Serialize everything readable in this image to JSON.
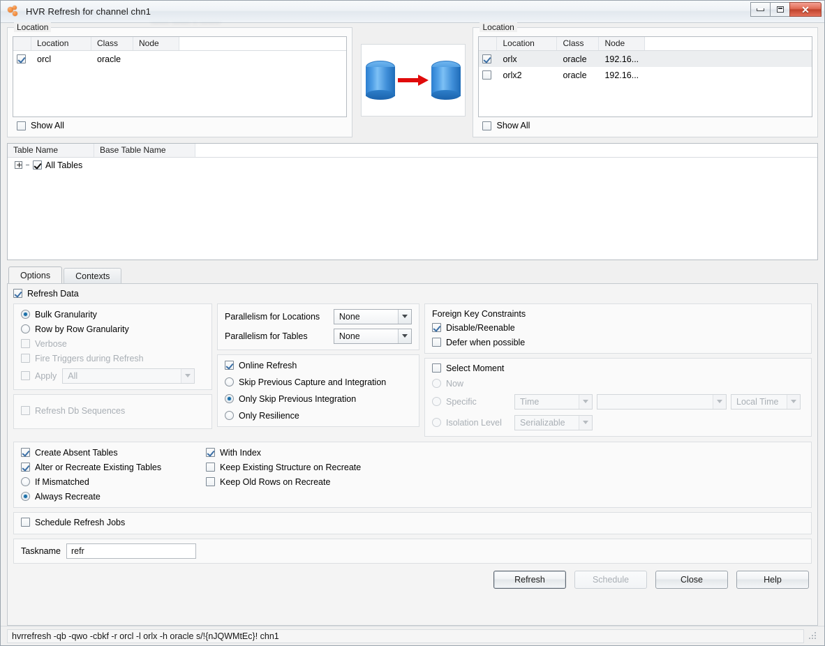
{
  "window": {
    "title": "HVR Refresh for channel chn1",
    "icon": "hvr-beads-icon",
    "ghost_text": "ghosted overlapping window text",
    "controls": {
      "minimize": "Minimize",
      "maximize": "Restore",
      "close": "Close"
    }
  },
  "source_location": {
    "group_title": "Location",
    "columns": [
      "Location",
      "Class",
      "Node"
    ],
    "rows": [
      {
        "checked": true,
        "location": "orcl",
        "class": "oracle",
        "node": ""
      }
    ],
    "show_all": {
      "label": "Show All",
      "checked": false
    }
  },
  "target_location": {
    "group_title": "Location",
    "columns": [
      "Location",
      "Class",
      "Node"
    ],
    "rows": [
      {
        "checked": true,
        "selected": true,
        "location": "orlx",
        "class": "oracle",
        "node": "192.16..."
      },
      {
        "checked": false,
        "selected": false,
        "location": "orlx2",
        "class": "oracle",
        "node": "192.16..."
      }
    ],
    "show_all": {
      "label": "Show All",
      "checked": false
    }
  },
  "transfer_graphic": {
    "source_icon": "database-cylinder-icon",
    "arrow_icon": "right-arrow-icon",
    "target_icon": "database-cylinder-icon"
  },
  "tables": {
    "columns": [
      "Table Name",
      "Base Table Name"
    ],
    "tree": [
      {
        "label": "All Tables",
        "checked": true,
        "expanded": false
      }
    ]
  },
  "tabs": [
    {
      "label": "Options",
      "active": true
    },
    {
      "label": "Contexts",
      "active": false
    }
  ],
  "options": {
    "refresh_data": {
      "label": "Refresh Data",
      "checked": true
    },
    "granularity": {
      "bulk": {
        "label": "Bulk Granularity",
        "selected": true,
        "disabled": false
      },
      "row_by_row": {
        "label": "Row by Row Granularity",
        "selected": false,
        "disabled": false
      },
      "verbose": {
        "label": "Verbose",
        "checked": false,
        "disabled": true
      },
      "fire_triggers": {
        "label": "Fire Triggers during Refresh",
        "checked": false,
        "disabled": true
      },
      "apply": {
        "label": "Apply",
        "checked": false,
        "disabled": true,
        "value": "All"
      }
    },
    "refresh_db_sequences": {
      "label": "Refresh Db Sequences",
      "checked": false,
      "disabled": true
    },
    "parallelism": {
      "locations_label": "Parallelism for Locations",
      "locations_value": "None",
      "tables_label": "Parallelism for Tables",
      "tables_value": "None"
    },
    "online_refresh": {
      "label": "Online Refresh",
      "checked": true,
      "modes": [
        {
          "label": "Skip Previous Capture and Integration",
          "selected": false,
          "disabled": false
        },
        {
          "label": "Only Skip Previous Integration",
          "selected": true,
          "disabled": false
        },
        {
          "label": "Only Resilience",
          "selected": false,
          "disabled": false
        }
      ]
    },
    "foreign_key_constraints": {
      "title": "Foreign Key Constraints",
      "disable_reenable": {
        "label": "Disable/Reenable",
        "checked": true
      },
      "defer_when_possible": {
        "label": "Defer when possible",
        "checked": false
      }
    },
    "select_moment": {
      "label": "Select Moment",
      "checked": false,
      "now": {
        "label": "Now",
        "selected": false,
        "disabled": true
      },
      "specific": {
        "label": "Specific",
        "selected": false,
        "disabled": true,
        "type_value": "Time",
        "detail_value": "",
        "zone_value": "Local Time"
      },
      "isolation_level": {
        "label": "Isolation Level",
        "selected": false,
        "disabled": true,
        "value": "Serializable"
      }
    },
    "create_tables": {
      "create_absent": {
        "label": "Create Absent Tables",
        "checked": true
      },
      "alter_or_recreate": {
        "label": "Alter or Recreate Existing Tables",
        "checked": true
      },
      "if_mismatched": {
        "label": "If Mismatched",
        "selected": false
      },
      "always_recreate": {
        "label": "Always Recreate",
        "selected": true
      },
      "with_index": {
        "label": "With Index",
        "checked": true
      },
      "keep_existing_structure": {
        "label": "Keep Existing Structure on Recreate",
        "checked": false
      },
      "keep_old_rows": {
        "label": "Keep Old Rows on Recreate",
        "checked": false
      }
    },
    "schedule_refresh_jobs": {
      "label": "Schedule Refresh Jobs",
      "checked": false
    },
    "taskname": {
      "label": "Taskname",
      "value": "refr",
      "placeholder": ""
    }
  },
  "buttons": {
    "refresh": {
      "label": "Refresh",
      "disabled": false,
      "default": true
    },
    "schedule": {
      "label": "Schedule",
      "disabled": true
    },
    "close": {
      "label": "Close",
      "disabled": false
    },
    "help": {
      "label": "Help",
      "disabled": false
    }
  },
  "statusbar": {
    "command": "hvrrefresh -qb -qwo -cbkf -r orcl -l orlx -h oracle s/!{nJQWMtEc}! chn1"
  }
}
